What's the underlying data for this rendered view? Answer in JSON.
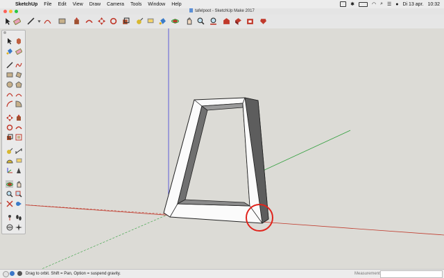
{
  "menubar": {
    "app": "SketchUp",
    "items": [
      "File",
      "Edit",
      "View",
      "Draw",
      "Camera",
      "Tools",
      "Window",
      "Help"
    ],
    "date": "Di 13 apr.",
    "time": "10:32"
  },
  "window": {
    "title": "tafelpoot - SketchUp Make 2017"
  },
  "toolbar": {
    "icons": [
      "select-icon",
      "eraser-icon",
      "pencil-icon",
      "line-icon",
      "arc-icon",
      "rectangle-icon",
      "pushpull-icon",
      "offset-icon",
      "move-icon",
      "rotate-icon",
      "scale-icon",
      "followme-icon",
      "tape-measure-icon",
      "paint-bucket-icon",
      "orbit-icon",
      "pan-icon",
      "zoom-icon",
      "zoom-extents-icon",
      "warehouse-icon",
      "components-icon",
      "extension-warehouse-icon",
      "layout-icon",
      "ruby-icon"
    ]
  },
  "palette": {
    "icons": [
      "select-icon",
      "eraser-icon",
      "paint-bucket-icon",
      "make-component-icon",
      "line-icon",
      "freehand-icon",
      "rectangle-icon",
      "rotated-rect-icon",
      "circle-icon",
      "polygon-icon",
      "arc-icon",
      "two-point-arc-icon",
      "three-point-arc-icon",
      "pie-icon",
      "move-icon",
      "pushpull-icon",
      "rotate-icon",
      "followme-icon",
      "scale-icon",
      "offset-icon",
      "tape-measure-icon",
      "dimension-icon",
      "protractor-icon",
      "text-icon",
      "axes-icon",
      "3d-text-icon",
      "orbit-icon",
      "pan-icon",
      "zoom-icon",
      "zoom-window-icon",
      "zoom-extents-icon",
      "previous-icon",
      "position-camera-icon",
      "walk-icon",
      "section-plane-icon",
      "look-around-icon"
    ]
  },
  "status": {
    "hint": "Drag to orbit. Shift = Pan, Option = suspend gravity.",
    "measurements_label": "Measurements",
    "measurements_value": ""
  },
  "colors": {
    "viewport": "#dcdbd6",
    "red_axis": "#c0392b",
    "green_axis": "#2e9e3a",
    "blue_axis": "#3b3bd9",
    "highlight": "#e0231c"
  }
}
